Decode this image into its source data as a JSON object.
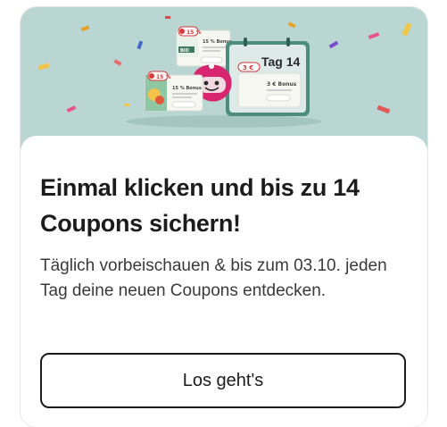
{
  "banner": {
    "coupon_left_badge": "15 %",
    "coupon_left_title": "15 % Bonus",
    "coupon_mid_badge": "15 %",
    "coupon_mid_title": "15 % Bonus",
    "coupon_mid_brand": "BIO",
    "calendar_label": "Tag 14",
    "calendar_price": "3 €",
    "calendar_bonus": "3 € Bonus",
    "colors": {
      "background": "#b9d6d3",
      "coupon_green": "#8fc6a4",
      "badge_red": "#d83a3a",
      "mascot_pink": "#d7266f",
      "calendar_green": "#4e8d7d"
    }
  },
  "card": {
    "headline": "Einmal klicken und bis zu 14 Coupons sichern!",
    "body": "Täglich vorbeischauen & bis zum 03.10. jeden Tag deine neuen Coupons entdecken.",
    "cta_label": "Los geht's"
  }
}
